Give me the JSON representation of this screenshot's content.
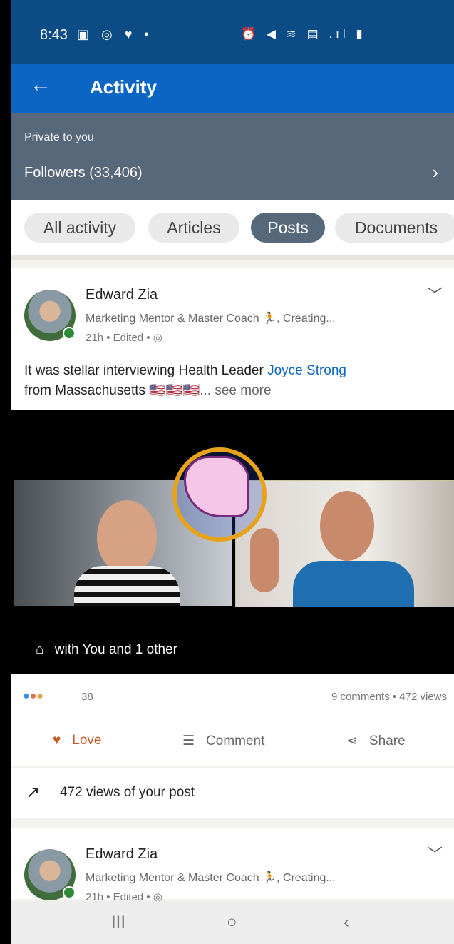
{
  "status_bar": {
    "time": "8:43",
    "left_icons": "▣ ◎ ♥ •",
    "right_icons": "⏰ ◀ ≋ ▤ .ıl ▮"
  },
  "app_bar": {
    "back_icon": "←",
    "title": "Activity"
  },
  "private_panel": {
    "caption": "Private to you",
    "followers": "Followers (33,406)",
    "chevron": "›"
  },
  "filters": {
    "chips": [
      "All activity",
      "Articles",
      "Posts",
      "Documents"
    ],
    "active": "Posts"
  },
  "post": {
    "author": "Edward Zia",
    "headline": "Marketing Mentor & Master Coach 🏃, Creating...",
    "meta": "21h • Edited • ◎",
    "text_prefix": "It was stellar interviewing Health Leader ",
    "mention": "Joyce Strong",
    "text_line2": "from Massachusetts 🇺🇸🇺🇸🇺🇸",
    "see_more": "... see more",
    "menu_icon": "﹀",
    "tag_icon": "⌂",
    "tag_text": "with You and 1 other",
    "reaction_icons": "●●●",
    "reaction_count": "38",
    "stats": "9 comments • 472 views",
    "actions": {
      "love": "Love",
      "comment": "Comment",
      "share": "Share"
    },
    "action_icons": {
      "love": "♥",
      "comment": "☰",
      "share": "⋖"
    },
    "views_icon": "↗",
    "views_text": "472 views of your post"
  },
  "post2": {
    "author": "Edward Zia",
    "headline": "Marketing Mentor & Master Coach 🏃, Creating...",
    "meta": "21h • Edited • ◎",
    "menu_icon": "﹀"
  },
  "nav_bar": {
    "recent": "III",
    "home": "○",
    "back": "‹"
  }
}
